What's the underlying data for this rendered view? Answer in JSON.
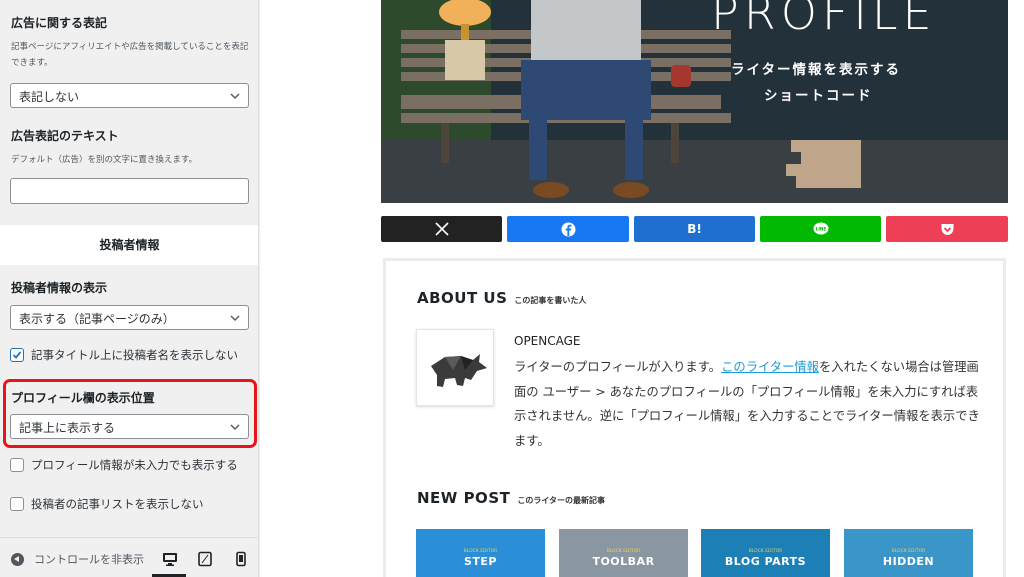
{
  "sidebar": {
    "ad_notice": {
      "title": "広告に関する表記",
      "description": "記事ページにアフィリエイトや広告を掲載していることを表記できます。",
      "select_value": "表記しない"
    },
    "ad_text": {
      "title": "広告表記のテキスト",
      "description": "デフォルト（広告）を別の文字に置き換えます。",
      "input_value": ""
    },
    "group_header": "投稿者情報",
    "author_display": {
      "title": "投稿者情報の表示",
      "select_value": "表示する（記事ページのみ）"
    },
    "checkbox_hide_name": {
      "label": "記事タイトル上に投稿者名を表示しない",
      "checked": true
    },
    "profile_position": {
      "title": "プロフィール欄の表示位置",
      "select_value": "記事上に表示する"
    },
    "checkbox_show_empty": {
      "label": "プロフィール情報が未入力でも表示する",
      "checked": false
    },
    "checkbox_hide_list": {
      "label": "投稿者の記事リストを表示しない",
      "checked": false
    },
    "footer": {
      "collapse_label": "コントロールを非表示",
      "devices": [
        "desktop-icon",
        "tablet-icon",
        "mobile-icon"
      ]
    }
  },
  "preview": {
    "hero": {
      "title": "PROFILE",
      "subtitle_line1": "ライター情報を表示する",
      "subtitle_line2": "ショートコード"
    },
    "share_buttons": [
      {
        "name": "x",
        "glyph": "𝕏",
        "color": "#222222"
      },
      {
        "name": "facebook",
        "glyph": "f",
        "color": "#1877f2"
      },
      {
        "name": "hatena",
        "glyph": "B!",
        "color": "#1f6fd0"
      },
      {
        "name": "line",
        "glyph": "LINE",
        "color": "#00b900"
      },
      {
        "name": "pocket",
        "glyph": "♥",
        "color": "#ef3f56"
      }
    ],
    "about": {
      "heading_en": "ABOUT US",
      "heading_jp": "この記事を書いた人",
      "author_name": "OPENCAGE",
      "bio_prefix": "ライターのプロフィールが入ります。",
      "bio_link": "このライター情報",
      "bio_suffix": "を入れたくない場合は管理画面の ユーザー > あなたのプロフィールの「プロフィール情報」を未入力にすれば表示されません。逆に「プロフィール情報」を入力することでライター情報を表示できます。"
    },
    "new_post": {
      "heading_en": "NEW POST",
      "heading_jp": "このライターの最新記事",
      "thumbs": [
        {
          "small": "BLOCK EDITOR",
          "big": "STEP",
          "color": "#2a8fd6"
        },
        {
          "small": "BLOCK EDITOR",
          "big": "TOOLBAR",
          "color": "#8a96a2"
        },
        {
          "small": "BLOCK EDITOR",
          "big": "BLOG PARTS",
          "color": "#1c7fb6"
        },
        {
          "small": "BLOCK EDITOR",
          "big": "HIDDEN",
          "color": "#3a95c8"
        }
      ]
    }
  }
}
